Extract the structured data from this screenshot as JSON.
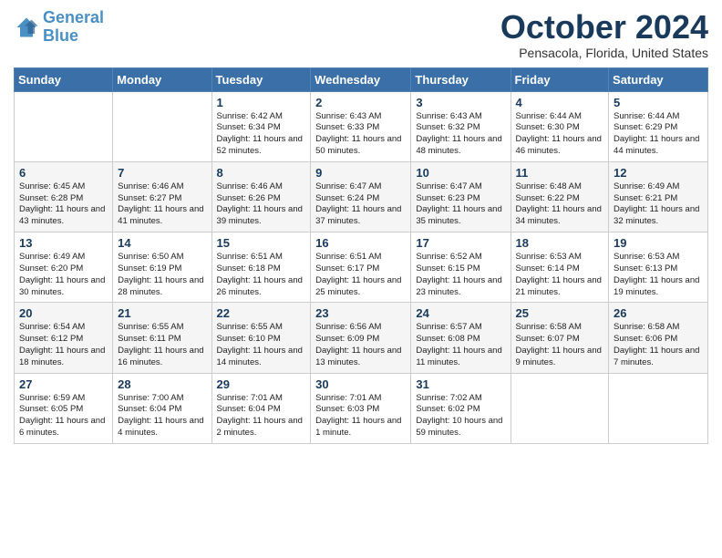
{
  "logo": {
    "line1": "General",
    "line2": "Blue"
  },
  "header": {
    "month": "October 2024",
    "location": "Pensacola, Florida, United States"
  },
  "days_of_week": [
    "Sunday",
    "Monday",
    "Tuesday",
    "Wednesday",
    "Thursday",
    "Friday",
    "Saturday"
  ],
  "weeks": [
    [
      {
        "day": "",
        "info": ""
      },
      {
        "day": "",
        "info": ""
      },
      {
        "day": "1",
        "info": "Sunrise: 6:42 AM\nSunset: 6:34 PM\nDaylight: 11 hours and 52 minutes."
      },
      {
        "day": "2",
        "info": "Sunrise: 6:43 AM\nSunset: 6:33 PM\nDaylight: 11 hours and 50 minutes."
      },
      {
        "day": "3",
        "info": "Sunrise: 6:43 AM\nSunset: 6:32 PM\nDaylight: 11 hours and 48 minutes."
      },
      {
        "day": "4",
        "info": "Sunrise: 6:44 AM\nSunset: 6:30 PM\nDaylight: 11 hours and 46 minutes."
      },
      {
        "day": "5",
        "info": "Sunrise: 6:44 AM\nSunset: 6:29 PM\nDaylight: 11 hours and 44 minutes."
      }
    ],
    [
      {
        "day": "6",
        "info": "Sunrise: 6:45 AM\nSunset: 6:28 PM\nDaylight: 11 hours and 43 minutes."
      },
      {
        "day": "7",
        "info": "Sunrise: 6:46 AM\nSunset: 6:27 PM\nDaylight: 11 hours and 41 minutes."
      },
      {
        "day": "8",
        "info": "Sunrise: 6:46 AM\nSunset: 6:26 PM\nDaylight: 11 hours and 39 minutes."
      },
      {
        "day": "9",
        "info": "Sunrise: 6:47 AM\nSunset: 6:24 PM\nDaylight: 11 hours and 37 minutes."
      },
      {
        "day": "10",
        "info": "Sunrise: 6:47 AM\nSunset: 6:23 PM\nDaylight: 11 hours and 35 minutes."
      },
      {
        "day": "11",
        "info": "Sunrise: 6:48 AM\nSunset: 6:22 PM\nDaylight: 11 hours and 34 minutes."
      },
      {
        "day": "12",
        "info": "Sunrise: 6:49 AM\nSunset: 6:21 PM\nDaylight: 11 hours and 32 minutes."
      }
    ],
    [
      {
        "day": "13",
        "info": "Sunrise: 6:49 AM\nSunset: 6:20 PM\nDaylight: 11 hours and 30 minutes."
      },
      {
        "day": "14",
        "info": "Sunrise: 6:50 AM\nSunset: 6:19 PM\nDaylight: 11 hours and 28 minutes."
      },
      {
        "day": "15",
        "info": "Sunrise: 6:51 AM\nSunset: 6:18 PM\nDaylight: 11 hours and 26 minutes."
      },
      {
        "day": "16",
        "info": "Sunrise: 6:51 AM\nSunset: 6:17 PM\nDaylight: 11 hours and 25 minutes."
      },
      {
        "day": "17",
        "info": "Sunrise: 6:52 AM\nSunset: 6:15 PM\nDaylight: 11 hours and 23 minutes."
      },
      {
        "day": "18",
        "info": "Sunrise: 6:53 AM\nSunset: 6:14 PM\nDaylight: 11 hours and 21 minutes."
      },
      {
        "day": "19",
        "info": "Sunrise: 6:53 AM\nSunset: 6:13 PM\nDaylight: 11 hours and 19 minutes."
      }
    ],
    [
      {
        "day": "20",
        "info": "Sunrise: 6:54 AM\nSunset: 6:12 PM\nDaylight: 11 hours and 18 minutes."
      },
      {
        "day": "21",
        "info": "Sunrise: 6:55 AM\nSunset: 6:11 PM\nDaylight: 11 hours and 16 minutes."
      },
      {
        "day": "22",
        "info": "Sunrise: 6:55 AM\nSunset: 6:10 PM\nDaylight: 11 hours and 14 minutes."
      },
      {
        "day": "23",
        "info": "Sunrise: 6:56 AM\nSunset: 6:09 PM\nDaylight: 11 hours and 13 minutes."
      },
      {
        "day": "24",
        "info": "Sunrise: 6:57 AM\nSunset: 6:08 PM\nDaylight: 11 hours and 11 minutes."
      },
      {
        "day": "25",
        "info": "Sunrise: 6:58 AM\nSunset: 6:07 PM\nDaylight: 11 hours and 9 minutes."
      },
      {
        "day": "26",
        "info": "Sunrise: 6:58 AM\nSunset: 6:06 PM\nDaylight: 11 hours and 7 minutes."
      }
    ],
    [
      {
        "day": "27",
        "info": "Sunrise: 6:59 AM\nSunset: 6:05 PM\nDaylight: 11 hours and 6 minutes."
      },
      {
        "day": "28",
        "info": "Sunrise: 7:00 AM\nSunset: 6:04 PM\nDaylight: 11 hours and 4 minutes."
      },
      {
        "day": "29",
        "info": "Sunrise: 7:01 AM\nSunset: 6:04 PM\nDaylight: 11 hours and 2 minutes."
      },
      {
        "day": "30",
        "info": "Sunrise: 7:01 AM\nSunset: 6:03 PM\nDaylight: 11 hours and 1 minute."
      },
      {
        "day": "31",
        "info": "Sunrise: 7:02 AM\nSunset: 6:02 PM\nDaylight: 10 hours and 59 minutes."
      },
      {
        "day": "",
        "info": ""
      },
      {
        "day": "",
        "info": ""
      }
    ]
  ]
}
